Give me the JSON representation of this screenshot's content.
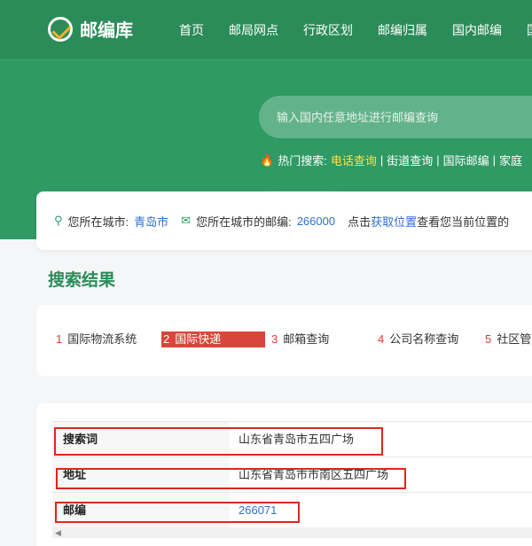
{
  "header": {
    "logo_text": "邮编库",
    "nav": [
      "首页",
      "邮局网点",
      "行政区划",
      "邮编归属",
      "国内邮编",
      "国"
    ]
  },
  "search": {
    "placeholder": "输入国内任意地址进行邮编查询"
  },
  "hot_search": {
    "label": "热门搜索:",
    "highlight": "电话查询",
    "items": [
      "街道查询",
      "国际邮编",
      "家庭"
    ]
  },
  "location": {
    "city_label": "您所在城市:",
    "city": "青岛市",
    "zip_label": "您所在城市的邮编:",
    "zip": "266000",
    "hint_prefix": "点击",
    "hint_link": "获取位置",
    "hint_suffix": "查看您当前位置的"
  },
  "results": {
    "title": "搜索结果"
  },
  "tabs": [
    {
      "num": "1",
      "label": "国际物流系统"
    },
    {
      "num": "2",
      "label": "国际快递"
    },
    {
      "num": "3",
      "label": "邮箱查询"
    },
    {
      "num": "4",
      "label": "公司名称查询"
    },
    {
      "num": "5",
      "label": "社区管"
    }
  ],
  "table": {
    "rows": [
      {
        "key": "搜索词",
        "value": "山东省青岛市五四广场"
      },
      {
        "key": "地址",
        "value": "山东省青岛市市南区五四广场"
      },
      {
        "key": "邮编",
        "value": "266071"
      }
    ]
  },
  "colors": {
    "brand_green": "#2f9a63",
    "highlight_red": "#e0261a",
    "link_blue": "#2f6fd1"
  }
}
